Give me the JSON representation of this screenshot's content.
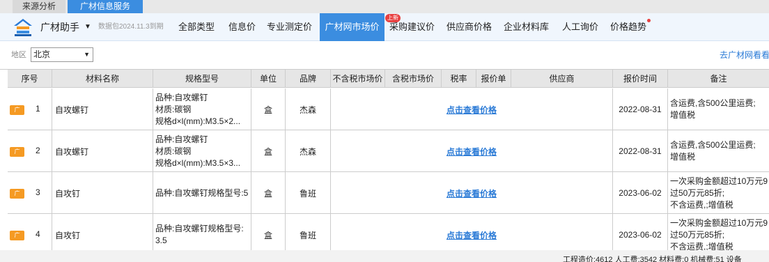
{
  "top_tabs": [
    "来源分析",
    "广材信息服务"
  ],
  "app": {
    "name": "广材助手",
    "caret": "▼",
    "package_note": "数据包2024.11.3到期"
  },
  "nav": {
    "items": [
      "全部类型",
      "信息价",
      "专业测定价",
      "广材网市场价",
      "采购建议价",
      "供应商价格",
      "企业材料库",
      "人工询价",
      "价格趋势"
    ],
    "active": "广材网市场价",
    "badge": "上新"
  },
  "filter": {
    "region_label": "地区",
    "region_value": "北京",
    "go_link": "去广材网看看"
  },
  "table": {
    "headers": [
      "序号",
      "材料名称",
      "规格型号",
      "单位",
      "品牌",
      "不含税市场价",
      "含税市场价",
      "税率",
      "报价单",
      "供应商",
      "报价时间",
      "备注"
    ],
    "tag_text": "广",
    "price_link": "点击查看价格",
    "rows": [
      {
        "no": "1",
        "name": "自攻螺钉",
        "spec": [
          "品种:自攻螺钉",
          "材质:碳钢",
          "规格d×l(mm):M3.5×2..."
        ],
        "unit": "盒",
        "brand": "杰森",
        "date": "2022-08-31",
        "remark": [
          "含运费,含500公里运费;",
          "增值税"
        ]
      },
      {
        "no": "2",
        "name": "自攻螺钉",
        "spec": [
          "品种:自攻螺钉",
          "材质:碳钢",
          "规格d×l(mm):M3.5×3..."
        ],
        "unit": "盒",
        "brand": "杰森",
        "date": "2022-08-31",
        "remark": [
          "含运费,含500公里运费;",
          "增值税"
        ]
      },
      {
        "no": "3",
        "name": "自攻钉",
        "spec": [
          "品种:自攻螺钉规格型号:5"
        ],
        "unit": "盒",
        "brand": "鲁班",
        "date": "2023-06-02",
        "remark": [
          "一次采购金额超过10万元9",
          "过50万元85折;",
          "不含运费,;增值税"
        ]
      },
      {
        "no": "4",
        "name": "自攻钉",
        "spec": [
          "品种:自攻螺钉规格型号:",
          "3.5"
        ],
        "unit": "盒",
        "brand": "鲁班",
        "date": "2023-06-02",
        "remark": [
          "一次采购金额超过10万元9",
          "过50万元85折;",
          "不含运费,;增值税"
        ]
      }
    ]
  },
  "status": {
    "text": "工程造价:4612   人工费:3542   材料费:0   机械费:51   设备"
  },
  "colors": {
    "accent": "#3b8de0",
    "link": "#2a7ad6",
    "tag": "#f59a23",
    "badge": "#e84040"
  }
}
